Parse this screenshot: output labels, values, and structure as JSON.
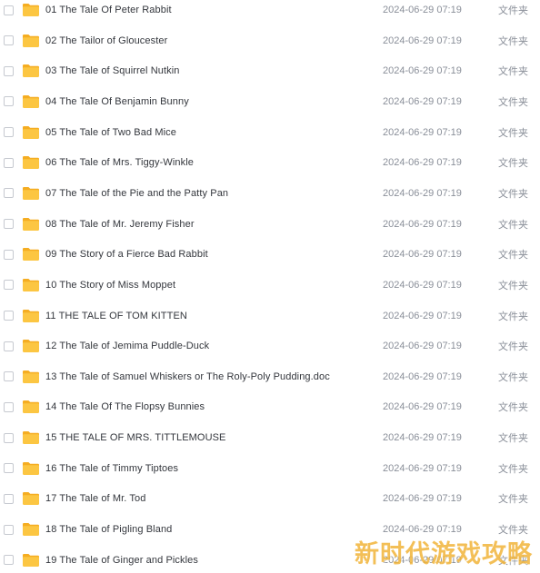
{
  "colors": {
    "folder_body": "#fcc642",
    "folder_tab": "#f5ad22",
    "name_text": "#33363c",
    "meta_text": "#8a8f99",
    "watermark": "#f2b53a"
  },
  "icon": "folder-icon",
  "rows": [
    {
      "name": "01 The Tale Of Peter Rabbit",
      "date": "2024-06-29 07:19",
      "type": "文件夹"
    },
    {
      "name": "02 The Tailor of Gloucester",
      "date": "2024-06-29 07:19",
      "type": "文件夹"
    },
    {
      "name": "03 The Tale of Squirrel Nutkin",
      "date": "2024-06-29 07:19",
      "type": "文件夹"
    },
    {
      "name": "04 The Tale Of Benjamin Bunny",
      "date": "2024-06-29 07:19",
      "type": "文件夹"
    },
    {
      "name": "05 The Tale of Two Bad Mice",
      "date": "2024-06-29 07:19",
      "type": "文件夹"
    },
    {
      "name": "06 The Tale of Mrs. Tiggy-Winkle",
      "date": "2024-06-29 07:19",
      "type": "文件夹"
    },
    {
      "name": "07 The Tale of the Pie and the Patty Pan",
      "date": "2024-06-29 07:19",
      "type": "文件夹"
    },
    {
      "name": "08 The Tale of Mr. Jeremy Fisher",
      "date": "2024-06-29 07:19",
      "type": "文件夹"
    },
    {
      "name": "09 The Story of a Fierce Bad Rabbit",
      "date": "2024-06-29 07:19",
      "type": "文件夹"
    },
    {
      "name": "10 The Story of Miss Moppet",
      "date": "2024-06-29 07:19",
      "type": "文件夹"
    },
    {
      "name": "11 THE TALE OF TOM KITTEN",
      "date": "2024-06-29 07:19",
      "type": "文件夹"
    },
    {
      "name": "12 The Tale of Jemima Puddle-Duck",
      "date": "2024-06-29 07:19",
      "type": "文件夹"
    },
    {
      "name": "13 The Tale of Samuel Whiskers or The Roly-Poly Pudding.doc",
      "date": "2024-06-29 07:19",
      "type": "文件夹"
    },
    {
      "name": "14 The Tale Of The Flopsy Bunnies",
      "date": "2024-06-29 07:19",
      "type": "文件夹"
    },
    {
      "name": "15 THE TALE OF MRS. TITTLEMOUSE",
      "date": "2024-06-29 07:19",
      "type": "文件夹"
    },
    {
      "name": "16 The Tale of Timmy Tiptoes",
      "date": "2024-06-29 07:19",
      "type": "文件夹"
    },
    {
      "name": "17 The Tale of Mr. Tod",
      "date": "2024-06-29 07:19",
      "type": "文件夹"
    },
    {
      "name": "18 The Tale of Pigling Bland",
      "date": "2024-06-29 07:19",
      "type": "文件夹"
    },
    {
      "name": "19 The Tale of Ginger and Pickles",
      "date": "2024-06-29 07:19",
      "type": "文件夹"
    }
  ],
  "watermark": "新时代游戏攻略"
}
